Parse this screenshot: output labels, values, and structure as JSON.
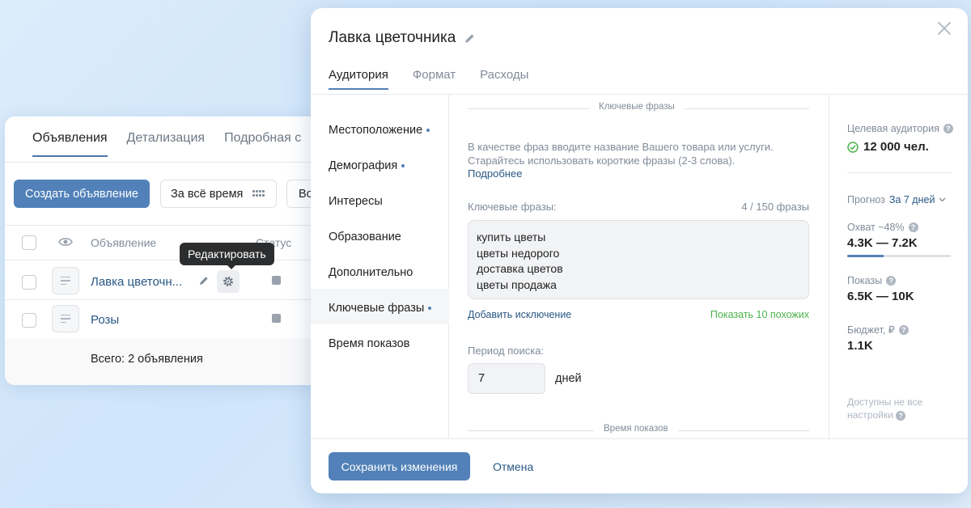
{
  "ads_panel": {
    "tabs": [
      "Объявления",
      "Детализация",
      "Подробная с"
    ],
    "create_button": "Создать объявление",
    "period_button": "За всё время",
    "extra_button": "Во",
    "columns": {
      "ad": "Объявление",
      "status": "Статус"
    },
    "rows": [
      {
        "name": "Лавка цветочн..."
      },
      {
        "name": "Розы"
      }
    ],
    "tooltip": "Редактировать",
    "total": "Всего: 2 объявления"
  },
  "modal": {
    "title": "Лавка цветочника",
    "tabs": [
      "Аудитория",
      "Формат",
      "Расходы"
    ],
    "sidebar": [
      {
        "label": "Местоположение"
      },
      {
        "label": "Демография"
      },
      {
        "label": "Интересы"
      },
      {
        "label": "Образование"
      },
      {
        "label": "Дополнительно"
      },
      {
        "label": "Ключевые фразы"
      },
      {
        "label": "Время показов"
      }
    ],
    "center": {
      "section_keywords": "Ключевые фразы",
      "hint": "В качестве фраз вводите название Вашего товара или услуги. Старайтесь использовать короткие фразы (2-3 слова).",
      "more_link": "Подробнее",
      "keywords_label": "Ключевые фразы:",
      "keywords_count": "4 / 150 фразы",
      "keywords": [
        "купить цветы",
        "цветы недорого",
        "доставка цветов",
        "цветы продажа"
      ],
      "add_exclusion": "Добавить исключение",
      "show_similar": "Показать 10 похожих",
      "period_label": "Период поиска:",
      "period_value": "7",
      "period_unit": "дней",
      "section_time": "Время показов"
    },
    "right": {
      "audience_label": "Целевая аудитория",
      "audience_value": "12 000 чел.",
      "forecast_label": "Прогноз",
      "forecast_link": "За 7 дней",
      "reach_label": "Охват ~48%",
      "reach_value": "4.3K — 7.2K",
      "reach_fraction": 0.35,
      "impressions_label": "Показы",
      "impressions_value": "6.5K — 10K",
      "budget_label": "Бюджет, ₽",
      "budget_value": "1.1K",
      "notice": "Доступны не все настройки"
    },
    "footer": {
      "save": "Сохранить изменения",
      "cancel": "Отмена"
    }
  }
}
